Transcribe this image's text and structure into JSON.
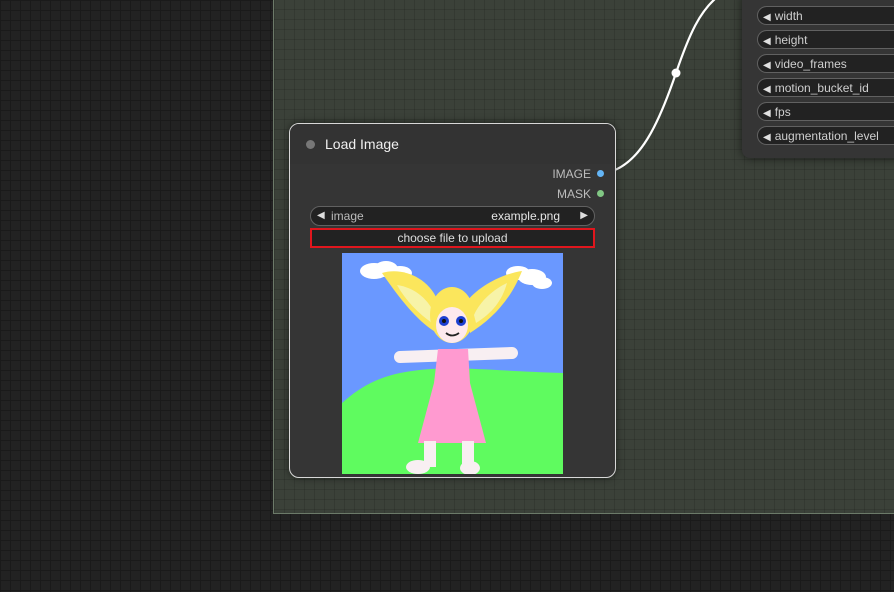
{
  "right_node": {
    "inputs": [
      {
        "label": "width"
      },
      {
        "label": "height"
      },
      {
        "label": "video_frames"
      },
      {
        "label": "motion_bucket_id"
      },
      {
        "label": "fps"
      },
      {
        "label": "augmentation_level"
      }
    ]
  },
  "load_image_node": {
    "title": "Load Image",
    "outputs": [
      {
        "label": "IMAGE",
        "color": "#64b5f6"
      },
      {
        "label": "MASK",
        "color": "#81c784"
      }
    ],
    "image_widget": {
      "label": "image",
      "value": "example.png"
    },
    "upload_button": {
      "label": "choose file to upload"
    },
    "preview": {
      "name": "image-preview"
    }
  },
  "colors": {
    "highlight": "#e0161d",
    "link": "#ffffff"
  }
}
